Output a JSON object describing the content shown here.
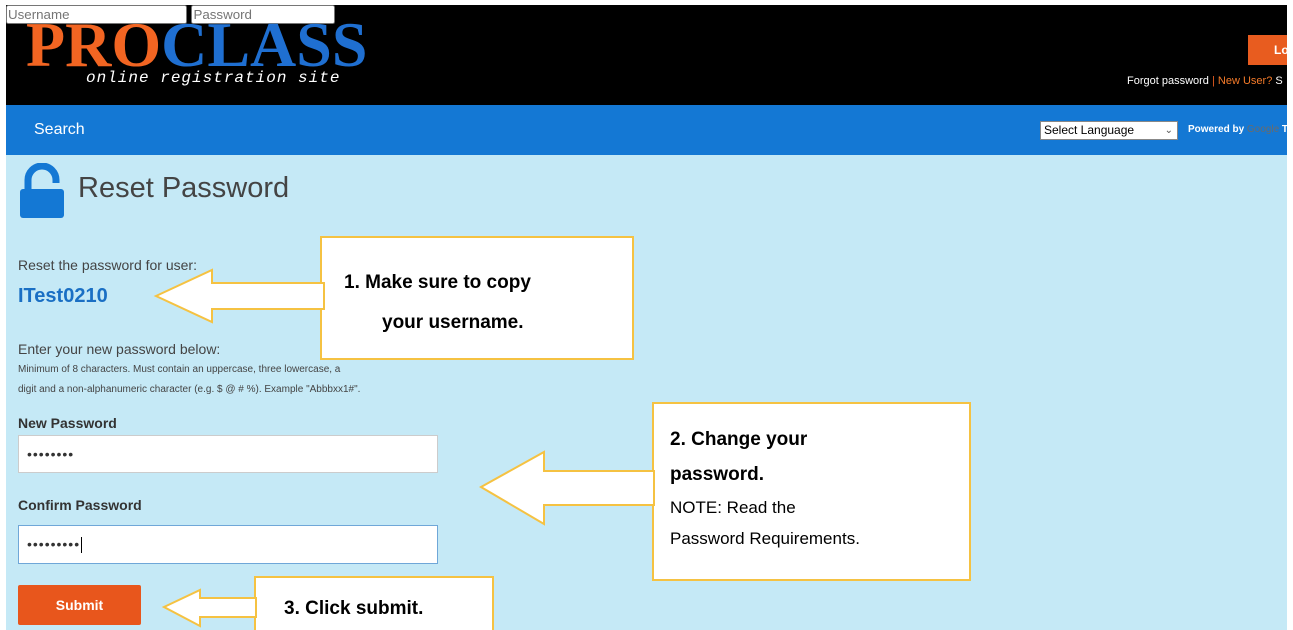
{
  "logo": {
    "pro": "PRO",
    "class": "CLASS",
    "tagline": "online registration site"
  },
  "header": {
    "username_placeholder": "Username",
    "password_placeholder": "Password",
    "login_label": "Lo",
    "forgot_password": "Forgot password",
    "separator": " | ",
    "new_user": "New User?",
    "trailing": " S"
  },
  "nav": {
    "search": "Search",
    "language_select": "Select Language",
    "powered_by": "Powered by ",
    "google": "Google",
    "trailing": " T"
  },
  "page": {
    "title": "Reset Password",
    "reset_label": "Reset the password for user:",
    "username": "ITest0210",
    "enter_label": "Enter your new password below:",
    "requirements_line1": "Minimum of 8 characters. Must contain an uppercase, three lowercase, a",
    "requirements_line2": "digit and a non-alphanumeric character (e.g. $ @ # %). Example \"Abbbxx1#\".",
    "new_password_label": "New Password",
    "new_password_value": "••••••••",
    "confirm_password_label": "Confirm Password",
    "confirm_password_value": "•••••••••",
    "submit_label": "Submit"
  },
  "callouts": {
    "c1_line1": "1.  Make sure to copy",
    "c1_line2": "your username.",
    "c2_line1": "2. Change your",
    "c2_line2": "password.",
    "c2_line3": "NOTE: Read the",
    "c2_line4": "Password Requirements.",
    "c3_line1": "3. Click submit."
  },
  "colors": {
    "header_bg": "#000000",
    "nav_bg": "#1478d4",
    "content_bg": "#c5e9f6",
    "brand_orange": "#f26522",
    "brand_blue": "#1f6fd1",
    "submit_bg": "#e8561c",
    "callout_border": "#f5c242"
  },
  "icons": {
    "lock": "unlocked-padlock-icon",
    "dropdown": "chevron-down-icon",
    "arrow": "left-arrow-icon"
  }
}
